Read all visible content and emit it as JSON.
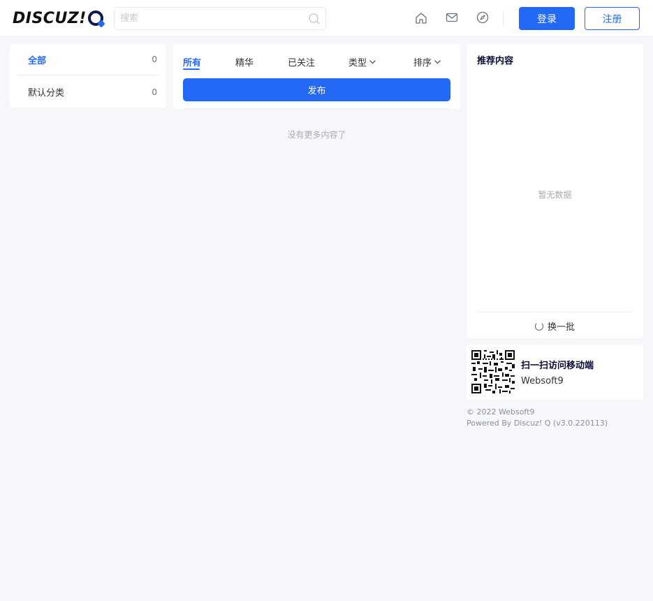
{
  "header": {
    "logo_text": "DISCUZ!",
    "search_placeholder": "搜索",
    "login_label": "登录",
    "register_label": "注册",
    "nav_icons": [
      "home-icon",
      "mail-icon",
      "compass-icon"
    ]
  },
  "categories": [
    {
      "name": "全部",
      "count": "0",
      "active": true
    },
    {
      "name": "默认分类",
      "count": "0",
      "active": false
    }
  ],
  "tabs": [
    {
      "label": "所有",
      "active": true
    },
    {
      "label": "精华",
      "active": false
    },
    {
      "label": "已关注",
      "active": false
    },
    {
      "label": "类型",
      "active": false,
      "has_dropdown": true
    },
    {
      "label": "排序",
      "active": false,
      "has_dropdown": true
    }
  ],
  "main": {
    "publish_label": "发布",
    "no_more_text": "没有更多内容了"
  },
  "recommend": {
    "title": "推荐内容",
    "empty_text": "暂无数据",
    "refresh_label": "换一批"
  },
  "qr": {
    "title": "扫一扫访问移动端",
    "site_name": "Websoft9"
  },
  "footer": {
    "copyright": "© 2022 Websoft9",
    "powered": "Powered By Discuz! Q (v3.0.220113)"
  },
  "colors": {
    "accent": "#2469f6",
    "background": "#f5f7fa",
    "muted_text": "#a8abb2"
  }
}
